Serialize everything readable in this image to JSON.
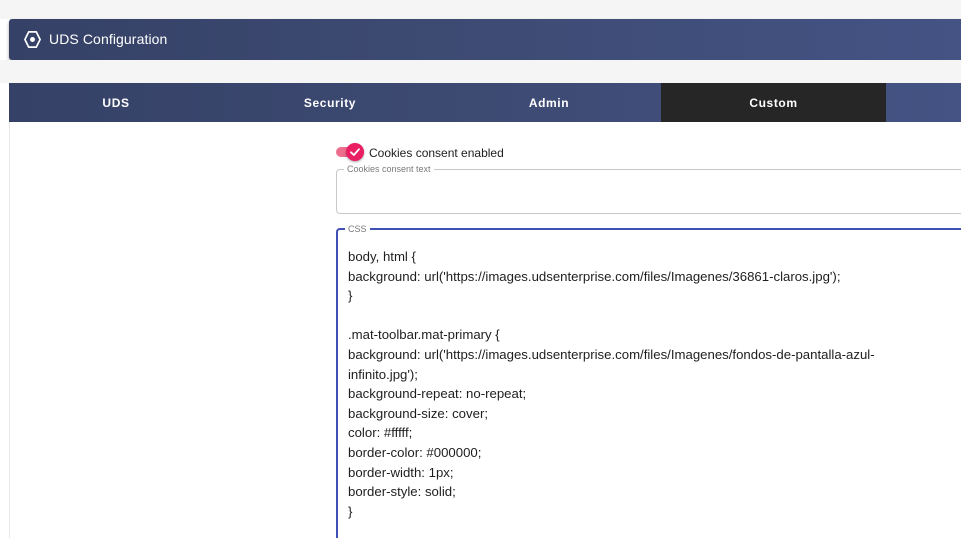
{
  "window": {
    "title": "UDS Configuration",
    "icon": "hexagon-dot-icon"
  },
  "tabs": [
    {
      "label": "UDS",
      "active": false
    },
    {
      "label": "Security",
      "active": false
    },
    {
      "label": "Admin",
      "active": false
    },
    {
      "label": "Custom",
      "active": true
    }
  ],
  "custom": {
    "cookies_toggle": {
      "label": "Cookies consent enabled",
      "checked": true,
      "color": "#e91e63"
    },
    "consent_text": {
      "legend": "Cookies consent text",
      "value": ""
    },
    "css": {
      "legend": "CSS",
      "lines": [
        "body, html {",
        "background: url('https://images.udsenterprise.com/files/Imagenes/36861-claros.jpg');",
        "}",
        "",
        ".mat-toolbar.mat-primary {",
        "background: url('https://images.udsenterprise.com/files/Imagenes/fondos-de-pantalla-azul-",
        "infinito.jpg');",
        "background-repeat: no-repeat;",
        "background-size: cover;",
        "color: #fffff;",
        "border-color: #000000;",
        "border-width: 1px;",
        "border-style: solid;",
        "}"
      ]
    }
  },
  "colors": {
    "header": "#3d4a72",
    "active_tab": "#262626",
    "focus": "#3f51b5"
  }
}
